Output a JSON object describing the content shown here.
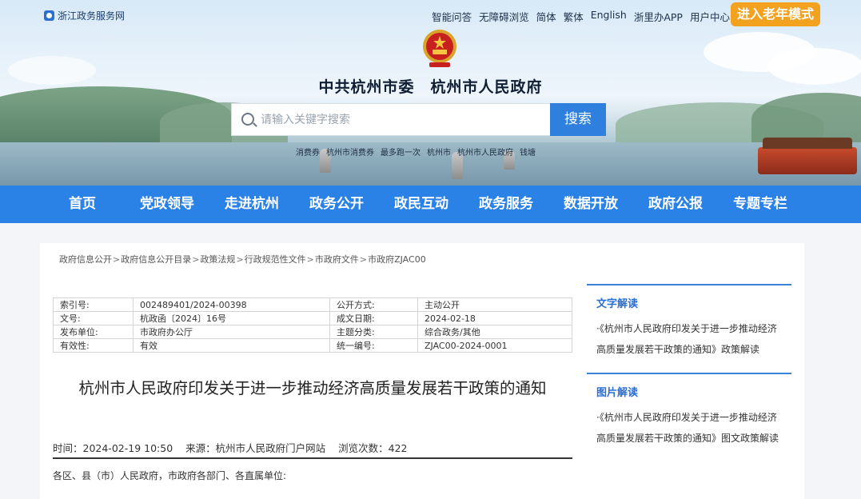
{
  "topbar": {
    "site_name": "浙江政务服务网",
    "links": [
      "智能问答",
      "无障碍浏览",
      "简体",
      "繁体",
      "English",
      "浙里办APP",
      "用户中心"
    ],
    "elder_mode": "进入老年模式"
  },
  "header": {
    "title": "中共杭州市委　杭州市人民政府",
    "search_placeholder": "请输入关键字搜索",
    "search_button": "搜索",
    "hotwords": [
      "消费券",
      "杭州市消费券",
      "最多跑一次",
      "杭州市",
      "杭州市人民政府",
      "钱塘"
    ]
  },
  "nav": [
    "首页",
    "党政领导",
    "走进杭州",
    "政务公开",
    "政民互动",
    "政务服务",
    "数据开放",
    "政府公报",
    "专题专栏"
  ],
  "breadcrumb": [
    "政府信息公开",
    "政府信息公开目录",
    "政策法规",
    "行政规范性文件",
    "市政府文件",
    "市政府ZJAC00"
  ],
  "meta_rows": [
    {
      "k1": "索引号:",
      "v1": "002489401/2024-00398",
      "k2": "公开方式:",
      "v2": "主动公开"
    },
    {
      "k1": "文号:",
      "v1": "杭政函〔2024〕16号",
      "k2": "成文日期:",
      "v2": "2024-02-18"
    },
    {
      "k1": "发布单位:",
      "v1": "市政府办公厅",
      "k2": "主题分类:",
      "v2": "综合政务/其他"
    },
    {
      "k1": "有效性:",
      "v1": "有效",
      "k2": "统一编号:",
      "v2": "ZJAC00-2024-0001"
    }
  ],
  "document": {
    "title": "杭州市人民政府印发关于进一步推动经济高质量发展若干政策的通知",
    "time": "时间：2024-02-19 10:50",
    "source": "来源：杭州市人民政府门户网站",
    "views": "浏览次数：422",
    "body_start": "各区、县（市）人民政府，市政府各部门、各直属单位:"
  },
  "sidebar": {
    "text_interpretation": {
      "title": "文字解读",
      "link": "·《杭州市人民政府印发关于进一步推动经济高质量发展若干政策的通知》政策解读"
    },
    "image_interpretation": {
      "title": "图片解读",
      "link": "·《杭州市人民政府印发关于进一步推动经济高质量发展若干政策的通知》图文政策解读"
    }
  },
  "colors": {
    "nav_blue": "#2b82e6",
    "elder_orange": "#f2a21e",
    "accent_blue": "#2a6fd6"
  }
}
